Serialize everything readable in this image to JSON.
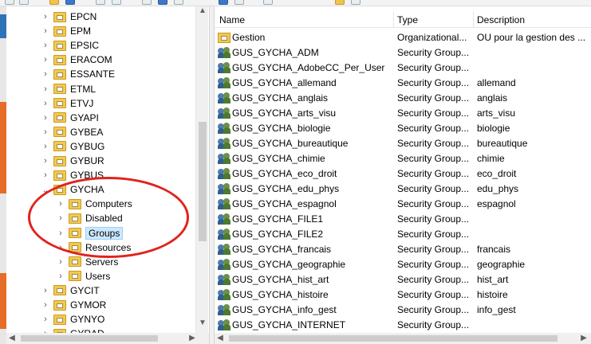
{
  "colors": {
    "selection": "#cce8ff",
    "annotation_circle": "#e0231c",
    "folder": "#f3c94e"
  },
  "tree": {
    "items": [
      {
        "label": "EPCN",
        "expanded": false
      },
      {
        "label": "EPM",
        "expanded": false
      },
      {
        "label": "EPSIC",
        "expanded": false
      },
      {
        "label": "ERACOM",
        "expanded": false
      },
      {
        "label": "ESSANTE",
        "expanded": false
      },
      {
        "label": "ETML",
        "expanded": false
      },
      {
        "label": "ETVJ",
        "expanded": false
      },
      {
        "label": "GYAPI",
        "expanded": false
      },
      {
        "label": "GYBEA",
        "expanded": false
      },
      {
        "label": "GYBUG",
        "expanded": false
      },
      {
        "label": "GYBUR",
        "expanded": false
      },
      {
        "label": "GYBUS",
        "expanded": false
      },
      {
        "label": "GYCHA",
        "expanded": true
      },
      {
        "label": "Computers",
        "expanded": false
      },
      {
        "label": "Disabled",
        "expanded": false
      },
      {
        "label": "Groups",
        "expanded": false,
        "selected": true
      },
      {
        "label": "Resources",
        "expanded": false
      },
      {
        "label": "Servers",
        "expanded": false
      },
      {
        "label": "Users",
        "expanded": false
      },
      {
        "label": "GYCIT",
        "expanded": false
      },
      {
        "label": "GYMOR",
        "expanded": false
      },
      {
        "label": "GYNYO",
        "expanded": false
      },
      {
        "label": "GYRAD",
        "expanded": false
      }
    ]
  },
  "list": {
    "columns": [
      "Name",
      "Type",
      "Description"
    ],
    "rows": [
      {
        "name": "Gestion",
        "type": "Organizational...",
        "description": "OU pour la gestion des ...",
        "icon": "ou-icon"
      },
      {
        "name": "GUS_GYCHA_ADM",
        "type": "Security Group...",
        "description": "",
        "icon": "group-icon"
      },
      {
        "name": "GUS_GYCHA_AdobeCC_Per_User",
        "type": "Security Group...",
        "description": "",
        "icon": "group-icon"
      },
      {
        "name": "GUS_GYCHA_allemand",
        "type": "Security Group...",
        "description": "allemand",
        "icon": "group-icon"
      },
      {
        "name": "GUS_GYCHA_anglais",
        "type": "Security Group...",
        "description": "anglais",
        "icon": "group-icon"
      },
      {
        "name": "GUS_GYCHA_arts_visu",
        "type": "Security Group...",
        "description": "arts_visu",
        "icon": "group-icon"
      },
      {
        "name": "GUS_GYCHA_biologie",
        "type": "Security Group...",
        "description": "biologie",
        "icon": "group-icon"
      },
      {
        "name": "GUS_GYCHA_bureautique",
        "type": "Security Group...",
        "description": "bureautique",
        "icon": "group-icon"
      },
      {
        "name": "GUS_GYCHA_chimie",
        "type": "Security Group...",
        "description": "chimie",
        "icon": "group-icon"
      },
      {
        "name": "GUS_GYCHA_eco_droit",
        "type": "Security Group...",
        "description": "eco_droit",
        "icon": "group-icon"
      },
      {
        "name": "GUS_GYCHA_edu_phys",
        "type": "Security Group...",
        "description": "edu_phys",
        "icon": "group-icon"
      },
      {
        "name": "GUS_GYCHA_espagnol",
        "type": "Security Group...",
        "description": "espagnol",
        "icon": "group-icon"
      },
      {
        "name": "GUS_GYCHA_FILE1",
        "type": "Security Group...",
        "description": "",
        "icon": "group-icon"
      },
      {
        "name": "GUS_GYCHA_FILE2",
        "type": "Security Group...",
        "description": "",
        "icon": "group-icon"
      },
      {
        "name": "GUS_GYCHA_francais",
        "type": "Security Group...",
        "description": "francais",
        "icon": "group-icon"
      },
      {
        "name": "GUS_GYCHA_geographie",
        "type": "Security Group...",
        "description": "geographie",
        "icon": "group-icon"
      },
      {
        "name": "GUS_GYCHA_hist_art",
        "type": "Security Group...",
        "description": "hist_art",
        "icon": "group-icon"
      },
      {
        "name": "GUS_GYCHA_histoire",
        "type": "Security Group...",
        "description": "histoire",
        "icon": "group-icon"
      },
      {
        "name": "GUS_GYCHA_info_gest",
        "type": "Security Group...",
        "description": "info_gest",
        "icon": "group-icon"
      },
      {
        "name": "GUS_GYCHA_INTERNET",
        "type": "Security Group...",
        "description": "",
        "icon": "group-icon"
      }
    ]
  }
}
